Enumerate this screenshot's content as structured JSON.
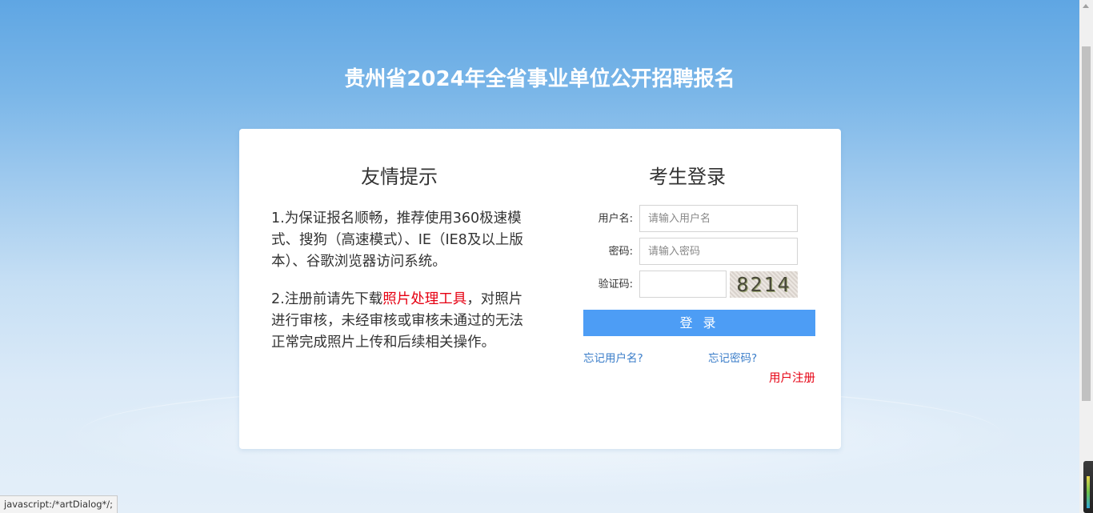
{
  "header": {
    "title": "贵州省2024年全省事业单位公开招聘报名"
  },
  "tips": {
    "title": "友情提示",
    "item1": "1.为保证报名顺畅，推荐使用360极速模式、搜狗（高速模式）、IE（IE8及以上版本）、谷歌浏览器访问系统。",
    "item2_prefix": "2.注册前请先下载",
    "item2_link": "照片处理工具",
    "item2_suffix": "，对照片进行审核，未经审核或审核未通过的无法正常完成照片上传和后续相关操作。"
  },
  "login": {
    "title": "考生登录",
    "username_label": "用户名:",
    "username_placeholder": "请输入用户名",
    "username_value": "",
    "password_label": "密码:",
    "password_placeholder": "请输入密码",
    "password_value": "",
    "captcha_label": "验证码:",
    "captcha_value": "",
    "captcha_image_text": "8214",
    "submit_label": "登 录",
    "forgot_username": "忘记用户名?",
    "forgot_password": "忘记密码?",
    "register": "用户注册"
  },
  "status_bar": {
    "text": "javascript:/*artDialog*/;"
  },
  "colors": {
    "accent_button": "#4d9df5",
    "link_blue": "#3a7dc9",
    "highlight_red": "#e60012",
    "background_top": "#5fa6e3",
    "background_bottom": "#e4eff9"
  }
}
